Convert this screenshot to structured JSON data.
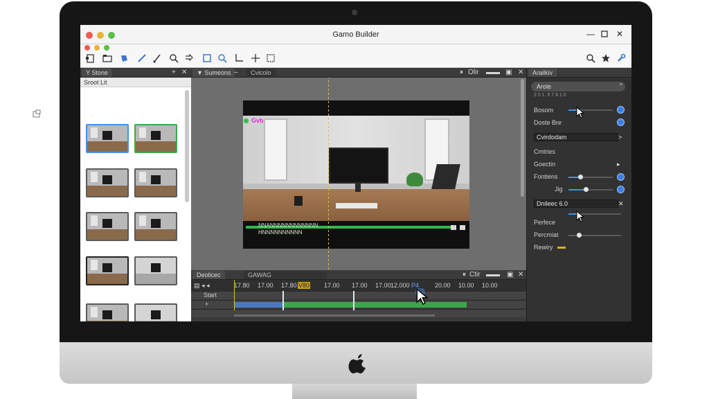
{
  "window": {
    "title": "Gamo Builder"
  },
  "toolbar": {
    "tools": [
      "new-document-icon",
      "open-folder-icon",
      "paint-bucket-icon",
      "pen-icon",
      "brush-icon",
      "magnifier-icon",
      "arrow-icon",
      "select-box-icon",
      "zoom-region-icon",
      "crop-icon",
      "move-icon",
      "transform-icon"
    ],
    "right_tools": [
      "search-icon",
      "star-icon",
      "wrench-icon"
    ]
  },
  "scene_panel": {
    "tab_label": "Y Stone",
    "subheader": "Sroot  Lit"
  },
  "stage_panel": {
    "tab_active": "▼ Sumeons",
    "tab_inactive": "Cvicolo",
    "right_label": "Olir",
    "overlay_badge": "Gvb",
    "caption_line1": "NNANNNNNNNNNNNN",
    "caption_line2": "HNNNNNNNNNN"
  },
  "timeline": {
    "tab_active": "Deolicec",
    "tab_inactive": "GAWAG",
    "right_label": "Ctir",
    "ticks": [
      {
        "label": "17.80",
        "style": "normal"
      },
      {
        "label": "17.00",
        "style": "normal"
      },
      {
        "label": "17.80",
        "style": "normal"
      },
      {
        "label": "V80",
        "style": "hl"
      },
      {
        "label": "17.00",
        "style": "normal"
      },
      {
        "label": "17.00",
        "style": "normal"
      },
      {
        "label": "17.00",
        "style": "normal"
      },
      {
        "label": "12.000",
        "style": "normal"
      },
      {
        "label": "P4",
        "style": "blue"
      },
      {
        "label": "20.00",
        "style": "normal"
      },
      {
        "label": "10.00",
        "style": "normal"
      },
      {
        "label": "10.00",
        "style": "normal"
      }
    ],
    "track1_label": "Start",
    "track2_label": "+"
  },
  "inspector": {
    "tab_label": "Arailkiv",
    "section_title": "Arole",
    "section_sub": "2 0 1. 5 7 8 1 0",
    "row_bosom": "Bosom",
    "row_double": "Doste Bre",
    "field_value": "Cvirdodam",
    "group_label": "Cmtries",
    "row_question": "Goectin",
    "row_fontiers": "Fontiens",
    "row_jig": "Jig",
    "field_dateline": "Dnileec  6.0",
    "row_perfect": "Perfece",
    "row_percent": "Percmiat",
    "row_reality": "Rewiry"
  },
  "colors": {
    "accent_blue": "#4a8fe7",
    "track_green": "#3aa84a",
    "highlight_yellow": "#c9a21c",
    "overlay_magenta": "#e02ee0"
  }
}
